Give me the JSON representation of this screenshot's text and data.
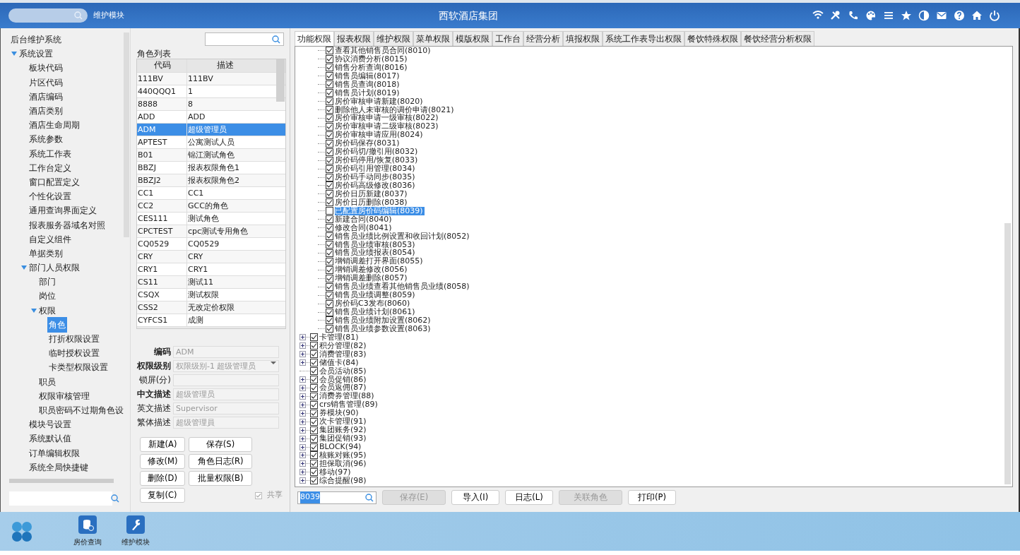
{
  "header": {
    "module": "维护模块",
    "title": "西软酒店集团"
  },
  "sidebar": {
    "title": "后台维护系统",
    "tree": [
      {
        "label": "系统设置",
        "expanded": true,
        "selected": false,
        "children": [
          {
            "label": "板块代码",
            "selected": false
          },
          {
            "label": "片区代码",
            "selected": false
          },
          {
            "label": "酒店编码",
            "selected": false
          },
          {
            "label": "酒店类别",
            "selected": false
          },
          {
            "label": "酒店生命周期",
            "selected": false
          },
          {
            "label": "系统参数",
            "selected": false
          },
          {
            "label": "系统工作表",
            "selected": false
          },
          {
            "label": "工作台定义",
            "selected": false
          },
          {
            "label": "窗口配置定义",
            "selected": false
          },
          {
            "label": "个性化设置",
            "selected": false
          },
          {
            "label": "通用查询界面定义",
            "selected": false
          },
          {
            "label": "报表服务器域名对照",
            "selected": false
          },
          {
            "label": "自定义组件",
            "selected": false
          },
          {
            "label": "单据类别",
            "selected": false
          },
          {
            "label": "部门人员权限",
            "expanded": true,
            "selected": false,
            "children": [
              {
                "label": "部门",
                "selected": false
              },
              {
                "label": "岗位",
                "selected": false
              },
              {
                "label": "权限",
                "expanded": true,
                "selected": false,
                "children": [
                  {
                    "label": "角色",
                    "selected": true
                  },
                  {
                    "label": "打折权限设置",
                    "selected": false
                  },
                  {
                    "label": "临时授权设置",
                    "selected": false
                  },
                  {
                    "label": "卡类型权限设置",
                    "selected": false
                  }
                ]
              },
              {
                "label": "职员",
                "selected": false
              },
              {
                "label": "权限审核管理",
                "selected": false
              },
              {
                "label": "职员密码不过期角色设",
                "selected": false
              }
            ]
          },
          {
            "label": "模块号设置",
            "selected": false
          },
          {
            "label": "系统默认值",
            "selected": false
          },
          {
            "label": "订单编辑权限",
            "selected": false
          },
          {
            "label": "系统全局快捷键",
            "selected": false
          }
        ]
      }
    ]
  },
  "roles": {
    "title": "角色列表",
    "columns": [
      "代码",
      "描述"
    ],
    "rows": [
      {
        "code": "111BV",
        "desc": "111BV",
        "selected": false
      },
      {
        "code": "440QQQ1",
        "desc": "1",
        "selected": false
      },
      {
        "code": "8888",
        "desc": "8",
        "selected": false
      },
      {
        "code": "ADD",
        "desc": "ADD",
        "selected": false
      },
      {
        "code": "ADM",
        "desc": "超级管理员",
        "selected": true
      },
      {
        "code": "APTEST",
        "desc": "公寓测试人员",
        "selected": false
      },
      {
        "code": "B01",
        "desc": "锦江测试角色",
        "selected": false
      },
      {
        "code": "BBZJ",
        "desc": "报表权限角色1",
        "selected": false
      },
      {
        "code": "BBZJ2",
        "desc": "报表权限角色2",
        "selected": false
      },
      {
        "code": "CC1",
        "desc": "CC1",
        "selected": false
      },
      {
        "code": "CC2",
        "desc": "GCC的角色",
        "selected": false
      },
      {
        "code": "CES111",
        "desc": "测试角色",
        "selected": false
      },
      {
        "code": "CPCTEST",
        "desc": "cpc测试专用角色",
        "selected": false
      },
      {
        "code": "CQ0529",
        "desc": "CQ0529",
        "selected": false
      },
      {
        "code": "CRY",
        "desc": "CRY",
        "selected": false
      },
      {
        "code": "CRY1",
        "desc": "CRY1",
        "selected": false
      },
      {
        "code": "CS11",
        "desc": "测试11",
        "selected": false
      },
      {
        "code": "CSQX",
        "desc": "测试权限",
        "selected": false
      },
      {
        "code": "CSS2",
        "desc": "无改定价权限",
        "selected": false
      },
      {
        "code": "CYFCS1",
        "desc": "成测",
        "selected": false
      }
    ]
  },
  "form": {
    "fields": [
      {
        "label": "编码",
        "required": true,
        "kind": "text",
        "value": "ADM",
        "disabled": true
      },
      {
        "label": "权限级别",
        "required": true,
        "kind": "select",
        "value": "权限级别-1 超级管理员",
        "disabled": true
      },
      {
        "label": "锁屏(分)",
        "required": false,
        "kind": "text",
        "disabled": true
      },
      {
        "label": "中文描述",
        "required": true,
        "kind": "text",
        "value": "超级管理员",
        "disabled": true
      },
      {
        "label": "英文描述",
        "required": false,
        "kind": "text",
        "value": "Supervisor",
        "disabled": true
      },
      {
        "label": "繁体描述",
        "required": false,
        "kind": "text",
        "value": "超级管理員",
        "disabled": true
      }
    ],
    "buttons": [
      [
        "新建(A)",
        "保存(S)"
      ],
      [
        "修改(M)",
        "角色日志(R)"
      ],
      [
        "删除(D)",
        "批量权限(B)"
      ],
      [
        "复制(C)"
      ]
    ],
    "share": {
      "label": "共享",
      "checked": true,
      "disabled": true
    }
  },
  "tabs": [
    {
      "label": "功能权限",
      "selected": true
    },
    {
      "label": "报表权限",
      "selected": false
    },
    {
      "label": "维护权限",
      "selected": false
    },
    {
      "label": "菜单权限",
      "selected": false
    },
    {
      "label": "模版权限",
      "selected": false
    },
    {
      "label": "工作台",
      "selected": false
    },
    {
      "label": "经营分析",
      "selected": false
    },
    {
      "label": "填报权限",
      "selected": false
    },
    {
      "label": "系统工作表导出权限",
      "selected": false
    },
    {
      "label": "餐饮特殊权限",
      "selected": false
    },
    {
      "label": "餐饮经营分析权限",
      "selected": false
    }
  ],
  "tree": {
    "sub_items": [
      {
        "label": "查看其他销售员合同(8010)",
        "checked": true,
        "selected": false
      },
      {
        "label": "协议消费分析(8015)",
        "checked": true,
        "selected": false
      },
      {
        "label": "销售分析查询(8016)",
        "checked": true,
        "selected": false
      },
      {
        "label": "销售员编辑(8017)",
        "checked": true,
        "selected": false
      },
      {
        "label": "销售员查询(8018)",
        "checked": true,
        "selected": false
      },
      {
        "label": "销售员计划(8019)",
        "checked": true,
        "selected": false
      },
      {
        "label": "房价审核申请新建(8020)",
        "checked": true,
        "selected": false
      },
      {
        "label": "删除他人未审核的调价申请(8021)",
        "checked": true,
        "selected": false
      },
      {
        "label": "房价审核申请一级审核(8022)",
        "checked": true,
        "selected": false
      },
      {
        "label": "房价审核申请二级审核(8023)",
        "checked": true,
        "selected": false
      },
      {
        "label": "房价审核申请应用(8024)",
        "checked": true,
        "selected": false
      },
      {
        "label": "房价码保存(8031)",
        "checked": true,
        "selected": false
      },
      {
        "label": "房价码切/撤引用(8032)",
        "checked": true,
        "selected": false
      },
      {
        "label": "房价码停用/恢复(8033)",
        "checked": true,
        "selected": false
      },
      {
        "label": "房价码引用管理(8034)",
        "checked": true,
        "selected": false
      },
      {
        "label": "房价码手动同步(8035)",
        "checked": true,
        "selected": false
      },
      {
        "label": "房价码高级修改(8036)",
        "checked": true,
        "selected": false
      },
      {
        "label": "房价日历新建(8037)",
        "checked": true,
        "selected": false
      },
      {
        "label": "房价日历删除(8038)",
        "checked": true,
        "selected": false
      },
      {
        "label": "已配置房价码编辑(8039)",
        "checked": false,
        "selected": true
      },
      {
        "label": "新建合同(8040)",
        "checked": true,
        "selected": false
      },
      {
        "label": "修改合同(8041)",
        "checked": true,
        "selected": false
      },
      {
        "label": "销售员业绩比例设置和收回计划(8052)",
        "checked": true,
        "selected": false
      },
      {
        "label": "销售员业绩审核(8053)",
        "checked": true,
        "selected": false
      },
      {
        "label": "销售员业绩报表(8054)",
        "checked": true,
        "selected": false
      },
      {
        "label": "增销调差打开界面(8055)",
        "checked": true,
        "selected": false
      },
      {
        "label": "增销调差修改(8056)",
        "checked": true,
        "selected": false
      },
      {
        "label": "增销调差删除(8057)",
        "checked": true,
        "selected": false
      },
      {
        "label": "销售员业绩查看其他销售员业绩(8058)",
        "checked": true,
        "selected": false
      },
      {
        "label": "销售员业绩调整(8059)",
        "checked": true,
        "selected": false
      },
      {
        "label": "房价码C3发布(8060)",
        "checked": true,
        "selected": false
      },
      {
        "label": "销售员业绩计划(8061)",
        "checked": true,
        "selected": false
      },
      {
        "label": "销售员业绩附加设置(8062)",
        "checked": true,
        "selected": false
      },
      {
        "label": "销售员业绩参数设置(8063)",
        "checked": true,
        "selected": false
      }
    ],
    "items": [
      {
        "label": "卡管理(81)",
        "checked": true,
        "expandable": true
      },
      {
        "label": "积分管理(82)",
        "checked": true,
        "expandable": true
      },
      {
        "label": "消费管理(83)",
        "checked": true,
        "expandable": true
      },
      {
        "label": "储值卡(84)",
        "checked": true,
        "expandable": true
      },
      {
        "label": "会员活动(85)",
        "checked": true,
        "expandable": false
      },
      {
        "label": "会员促销(86)",
        "checked": true,
        "expandable": true
      },
      {
        "label": "会员返佣(87)",
        "checked": true,
        "expandable": true
      },
      {
        "label": "消费券管理(88)",
        "checked": true,
        "expandable": true
      },
      {
        "label": "crs销售管理(89)",
        "checked": true,
        "expandable": true
      },
      {
        "label": "券模块(90)",
        "checked": true,
        "expandable": true
      },
      {
        "label": "次卡管理(91)",
        "checked": true,
        "expandable": true
      },
      {
        "label": "集团账务(92)",
        "checked": true,
        "expandable": true
      },
      {
        "label": "集团促销(93)",
        "checked": true,
        "expandable": true
      },
      {
        "label": "BLOCK(94)",
        "checked": true,
        "expandable": true
      },
      {
        "label": "核账对账(95)",
        "checked": true,
        "expandable": true
      },
      {
        "label": "担保取消(96)",
        "checked": true,
        "expandable": true
      },
      {
        "label": "移动(97)",
        "checked": true,
        "expandable": true
      },
      {
        "label": "综合提醒(98)",
        "checked": true,
        "expandable": true
      }
    ]
  },
  "toolbar": {
    "search": {
      "value": "8039"
    },
    "buttons": [
      {
        "label": "保存(E)",
        "disabled": true
      },
      {
        "label": "导入(I)",
        "disabled": false
      },
      {
        "label": "日志(L)",
        "disabled": false
      },
      {
        "label": "关联角色",
        "disabled": true
      },
      {
        "label": "打印(P)",
        "disabled": false
      }
    ]
  },
  "taskbar": {
    "apps": [
      {
        "label": "房价查询",
        "kind": "database"
      },
      {
        "label": "维护模块",
        "kind": "wrench"
      }
    ]
  }
}
